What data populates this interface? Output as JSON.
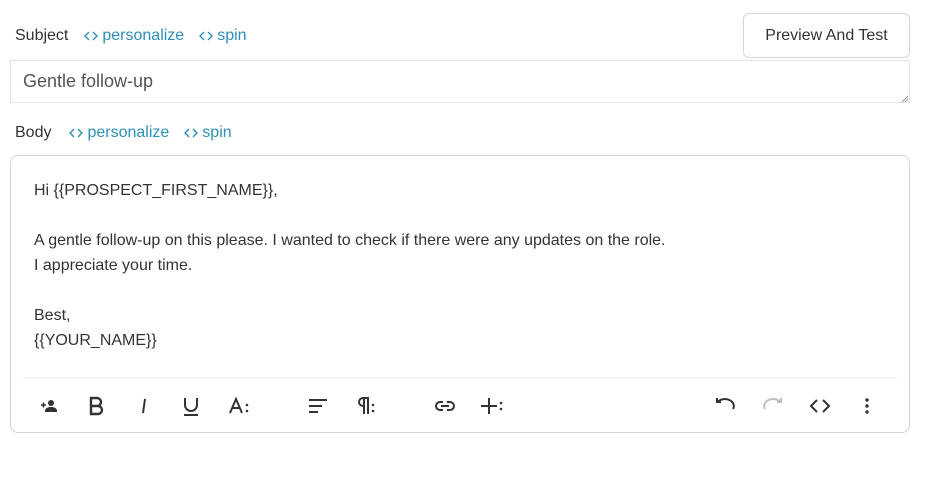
{
  "subject": {
    "label": "Subject",
    "personalize": "personalize",
    "spin": "spin",
    "value": "Gentle follow-up"
  },
  "preview_button": "Preview And Test",
  "body": {
    "label": "Body",
    "personalize": "personalize",
    "spin": "spin",
    "lines": [
      "Hi {{PROSPECT_FIRST_NAME}},",
      "",
      "A gentle follow-up on this please. I wanted to check if there were any updates on the role.",
      "I appreciate your time.",
      "",
      "Best,",
      "{{YOUR_NAME}}"
    ]
  },
  "toolbar": {
    "icons": [
      "add-person-icon",
      "bold-icon",
      "italic-icon",
      "underline-icon",
      "font-size-icon",
      "align-icon",
      "paragraph-icon",
      "link-icon",
      "insert-icon",
      "undo-icon",
      "redo-icon",
      "code-icon",
      "more-vert-icon"
    ]
  },
  "colors": {
    "link": "#2e8fb8",
    "text": "#333333",
    "border": "#d3d3d3"
  }
}
